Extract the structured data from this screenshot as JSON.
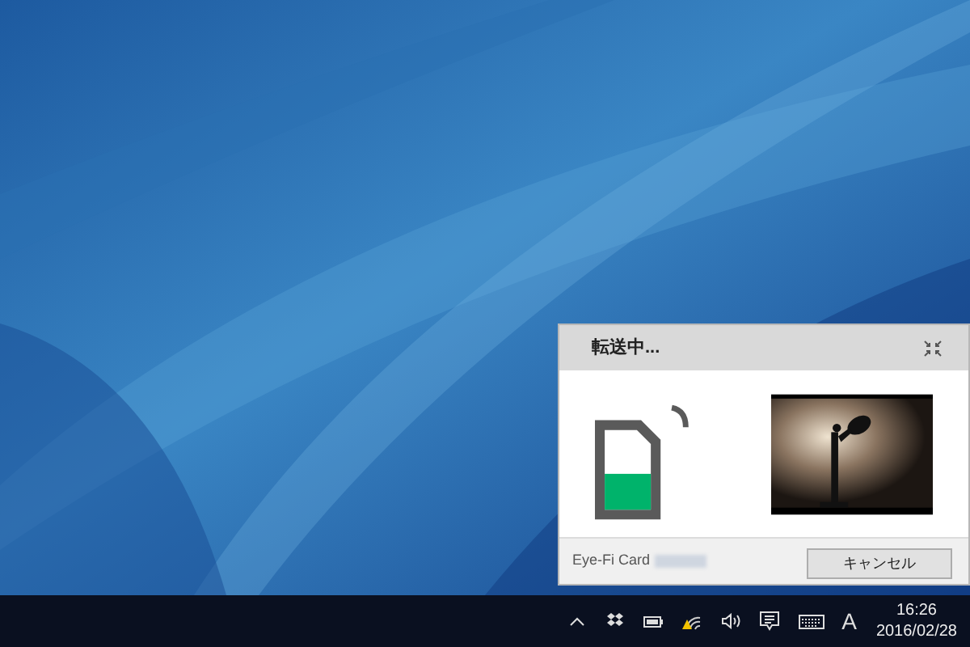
{
  "dialog": {
    "title": "転送中...",
    "card_label": "Eye-Fi Card",
    "card_fill": {
      "level": 0.45
    },
    "buttons": [
      "キャンセル"
    ]
  },
  "taskbar": {
    "input_indicator": "A",
    "time": "16:26",
    "date": "2016/02/28"
  }
}
